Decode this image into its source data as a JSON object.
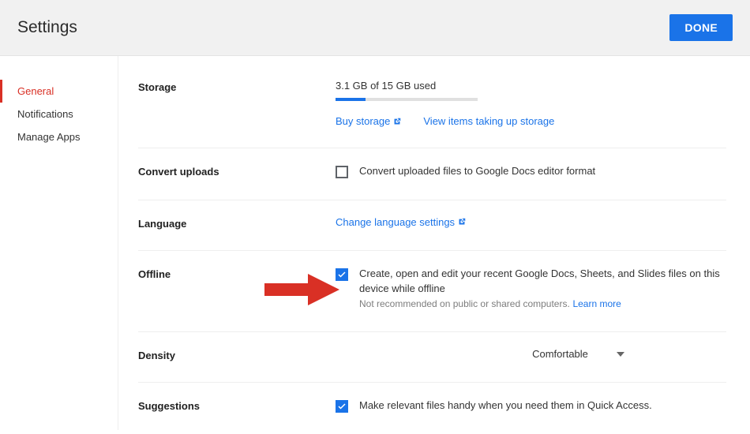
{
  "header": {
    "title": "Settings",
    "done_label": "DONE"
  },
  "sidebar": {
    "items": [
      "General",
      "Notifications",
      "Manage Apps"
    ],
    "active_index": 0
  },
  "sections": {
    "storage": {
      "label": "Storage",
      "text": "3.1 GB of 15 GB used",
      "progress_percent": 21,
      "buy_link": "Buy storage",
      "view_link": "View items taking up storage"
    },
    "convert": {
      "label": "Convert uploads",
      "checkbox_label": "Convert uploaded files to Google Docs editor format",
      "checked": false
    },
    "language": {
      "label": "Language",
      "link": "Change language settings"
    },
    "offline": {
      "label": "Offline",
      "checkbox_label": "Create, open and edit your recent Google Docs, Sheets, and Slides files on this device while offline",
      "checked": true,
      "hint": "Not recommended on public or shared computers.",
      "learn_more": "Learn more"
    },
    "density": {
      "label": "Density",
      "value": "Comfortable"
    },
    "suggestions": {
      "label": "Suggestions",
      "checkbox_label": "Make relevant files handy when you need them in Quick Access.",
      "checked": true
    }
  }
}
